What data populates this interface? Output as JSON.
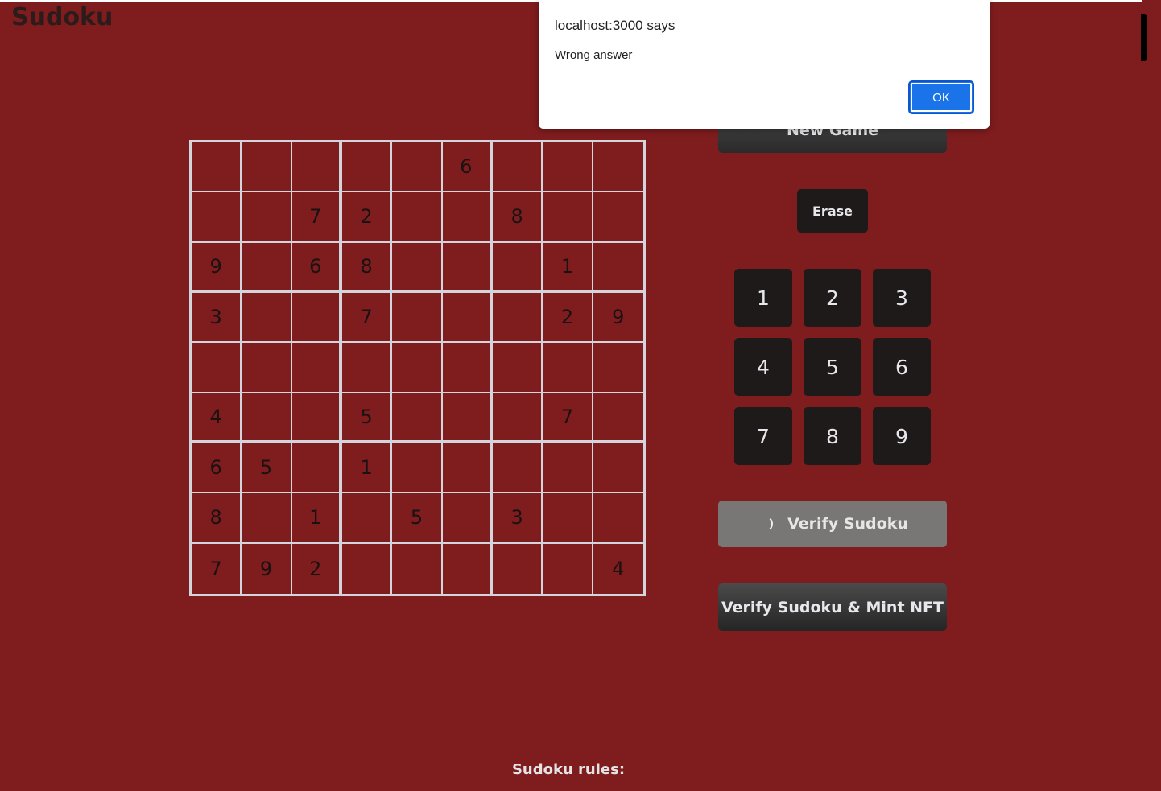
{
  "app": {
    "title": "Sudoku"
  },
  "board": {
    "cells": [
      [
        "",
        "",
        "",
        "",
        "",
        "6",
        "",
        "",
        ""
      ],
      [
        "",
        "",
        "7",
        "2",
        "",
        "",
        "8",
        "",
        ""
      ],
      [
        "9",
        "",
        "6",
        "8",
        "",
        "",
        "",
        "1",
        ""
      ],
      [
        "3",
        "",
        "",
        "7",
        "",
        "",
        "",
        "2",
        "9"
      ],
      [
        "",
        "",
        "",
        "",
        "",
        "",
        "",
        "",
        ""
      ],
      [
        "4",
        "",
        "",
        "5",
        "",
        "",
        "",
        "7",
        ""
      ],
      [
        "6",
        "5",
        "",
        "1",
        "",
        "",
        "",
        "",
        ""
      ],
      [
        "8",
        "",
        "1",
        "",
        "5",
        "",
        "3",
        "",
        ""
      ],
      [
        "7",
        "9",
        "2",
        "",
        "",
        "",
        "",
        "",
        "4"
      ]
    ]
  },
  "controls": {
    "new_game_label": "New Game",
    "erase_label": "Erase",
    "numbers": [
      "1",
      "2",
      "3",
      "4",
      "5",
      "6",
      "7",
      "8",
      "9"
    ],
    "verify_label": "Verify Sudoku",
    "verify_mint_label": "Verify Sudoku & Mint NFT"
  },
  "footer": {
    "rules_label": "Sudoku rules:"
  },
  "dialog": {
    "title": "localhost:3000 says",
    "message": "Wrong answer",
    "ok_label": "OK"
  },
  "colors": {
    "background": "#7f1c1e",
    "button_dark": "#1e1a1a",
    "dialog_button": "#1a73e8"
  }
}
